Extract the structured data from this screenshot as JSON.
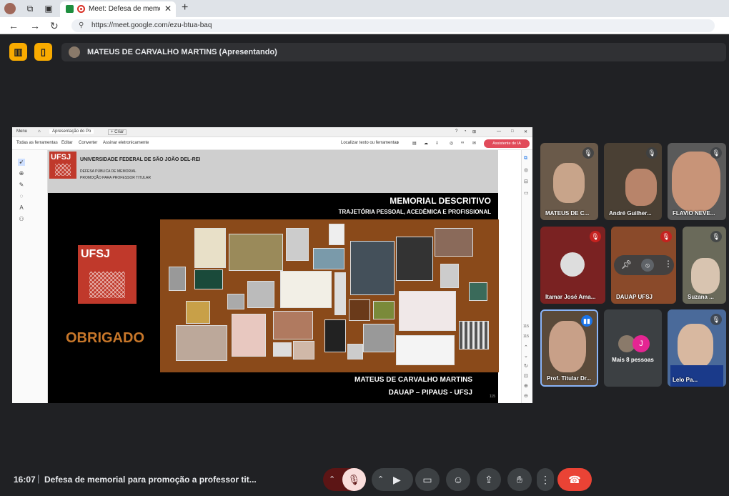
{
  "browser": {
    "tab_title": "Meet: Defesa de memorial p",
    "url": "https://meet.google.com/ezu-btua-baq"
  },
  "meet": {
    "presenter_label": "MATEUS DE CARVALHO MARTINS (Apresentando)",
    "time": "16:07",
    "meeting_title": "Defesa de memorial para promoção a professor tit..."
  },
  "pdf": {
    "menu": "Menu",
    "tab": "Apresentação do Po",
    "create": "+ Criar",
    "tools": [
      "Todas as ferramentas",
      "Editar",
      "Converter",
      "Assinar eletronicamente"
    ],
    "search": "Localizar texto ou ferramentas",
    "ai_button": "Assistente de IA",
    "page_a": "115",
    "page_b": "115"
  },
  "slide": {
    "logo_small": "UFSJ",
    "university": "UNIVERSIDADE FEDERAL DE SÃO JOÃO DEL-REI",
    "defesa": "DEFESA PÚBLICA DE MEMORIAL",
    "promocao": "PROMOÇÃO PARA PROFESSOR TITULAR",
    "title": "MEMORIAL DESCRITIVO",
    "subtitle": "TRAJETÓRIA PESSOAL, ACEDÊMICA E PROFISSIONAL",
    "logo_big": "UFSJ",
    "thanks": "OBRIGADO",
    "author": "MATEUS DE CARVALHO MARTINS",
    "dept": "DAUAP – PIPAUS - UFSJ",
    "page": "115"
  },
  "participants": [
    {
      "name": "MATEUS DE C..."
    },
    {
      "name": "André Guilher..."
    },
    {
      "name": "FLAVIO NEVE..."
    },
    {
      "name": "Itamar José Ama..."
    },
    {
      "name": "DAUAP UFSJ"
    },
    {
      "name": "Suzana ..."
    },
    {
      "name": "Prof. Titular Dr..."
    },
    {
      "name": "Mais 8 pessoas"
    },
    {
      "name": "Lelo Pa..."
    }
  ],
  "avatar_initial": "J",
  "colors": {
    "accent": "#f9ab00",
    "end_call": "#ea4335",
    "mute_red": "#c5221f"
  }
}
